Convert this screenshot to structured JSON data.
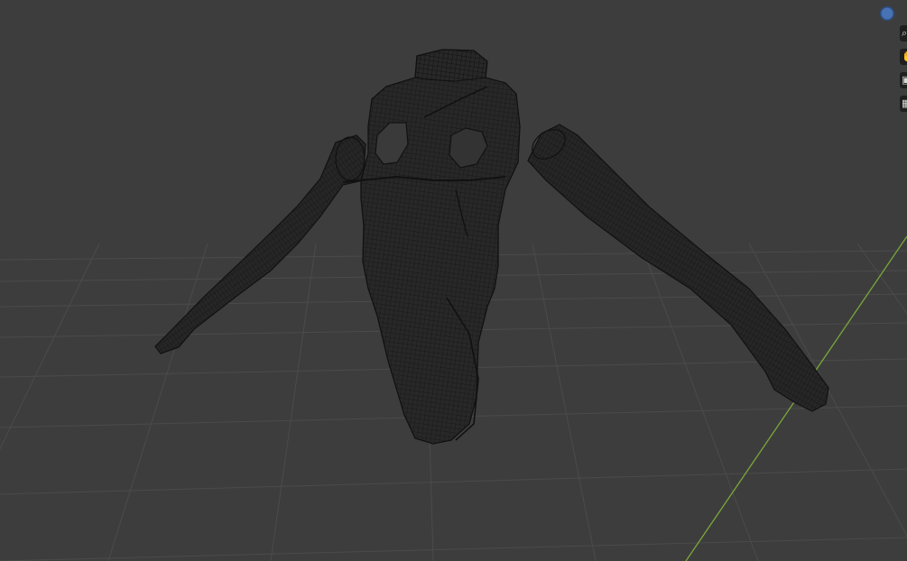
{
  "viewport": {
    "background_color": "#3d3d3d",
    "grid_color": "#4a4a4a",
    "y_axis_color": "#7aa83a",
    "wire_color": "#151515",
    "mesh_fill_color": "#2a2a2a"
  },
  "overlay": {
    "gizmo_color": "#4772b3",
    "edge_tool_icons": [
      "zoom-icon",
      "hand-pan-icon",
      "camera-icon",
      "grid-icon"
    ]
  }
}
